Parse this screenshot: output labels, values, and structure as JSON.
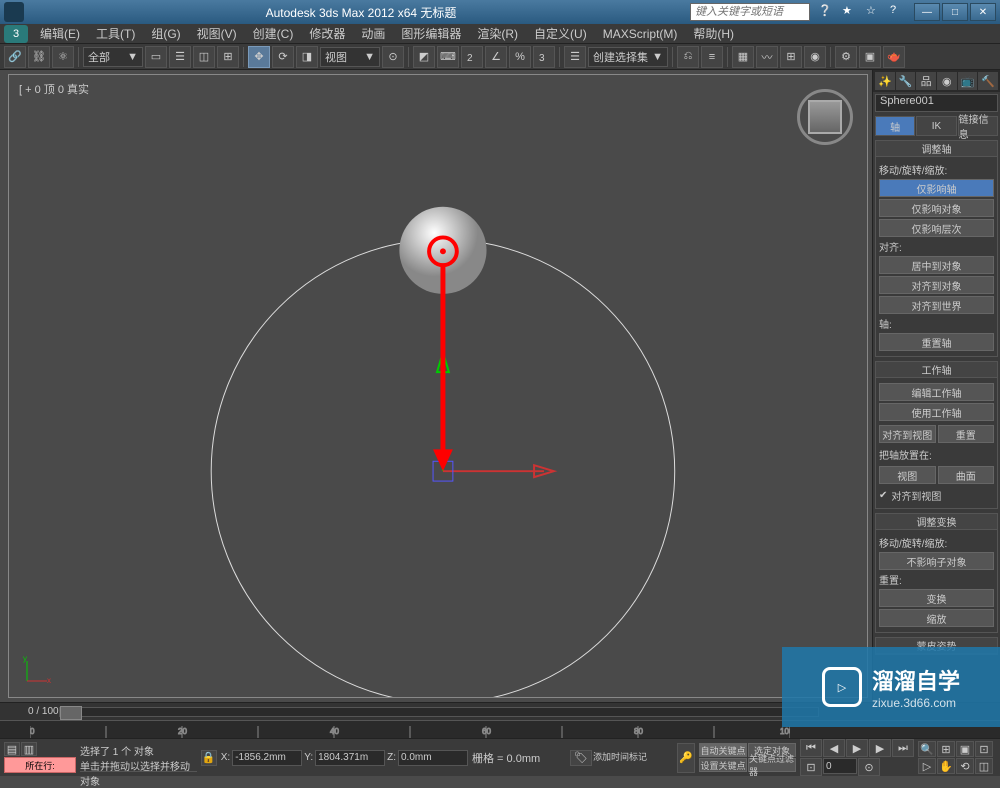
{
  "titlebar": {
    "title": "Autodesk 3ds Max 2012 x64   无标题",
    "search_placeholder": "键入关键字或短语"
  },
  "menu": {
    "items": [
      "编辑(E)",
      "工具(T)",
      "组(G)",
      "视图(V)",
      "创建(C)",
      "修改器",
      "动画",
      "图形编辑器",
      "渲染(R)",
      "自定义(U)",
      "MAXScript(M)",
      "帮助(H)"
    ]
  },
  "toolbar": {
    "selection_set_label": "全部",
    "view_label": "视图",
    "selection_dropdown": "创建选择集"
  },
  "viewport": {
    "label": "[ + 0 顶 0 真实"
  },
  "right_panel": {
    "object_name": "Sphere001",
    "tabs": [
      "轴",
      "IK",
      "链接信息"
    ],
    "rollout1": {
      "title": "调整轴",
      "section1_label": "移动/旋转/缩放:",
      "btn1": "仅影响轴",
      "btn2": "仅影响对象",
      "btn3": "仅影响层次",
      "section2_label": "对齐:",
      "btn4": "居中到对象",
      "btn5": "对齐到对象",
      "btn6": "对齐到世界",
      "section3_label": "轴:",
      "btn7": "重置轴"
    },
    "rollout2": {
      "title": "工作轴",
      "btn1": "编辑工作轴",
      "btn2": "使用工作轴",
      "btn3": "对齐到视图",
      "btn4": "重置",
      "section1_label": "把轴放置在:",
      "btn5": "视图",
      "btn6": "曲面",
      "check1": "对齐到视图"
    },
    "rollout3": {
      "title": "调整变换",
      "section1_label": "移动/旋转/缩放:",
      "btn1": "不影响子对象",
      "section2_label": "重置:",
      "btn2": "变换",
      "btn3": "缩放"
    },
    "rollout4": {
      "title": "蒙皮姿势"
    }
  },
  "timeline": {
    "frame_label": "0 / 100"
  },
  "status": {
    "selected": "选择了 1 个 对象",
    "hint": "单击并拖动以选择并移动对象",
    "btn_label": "所在行:",
    "x_label": "X:",
    "x_val": "-1856.2mm",
    "y_label": "Y:",
    "y_val": "1804.371m",
    "z_label": "Z:",
    "z_val": "0.0mm",
    "grid_label": "栅格 = 0.0mm",
    "auto_key": "自动关键点",
    "sel_set": "选定对象",
    "set_key": "设置关键点",
    "key_filter": "关键点过滤器",
    "timeline_hint": "添加时间标记"
  },
  "watermark": {
    "big": "溜溜自学",
    "small": "zixue.3d66.com"
  }
}
